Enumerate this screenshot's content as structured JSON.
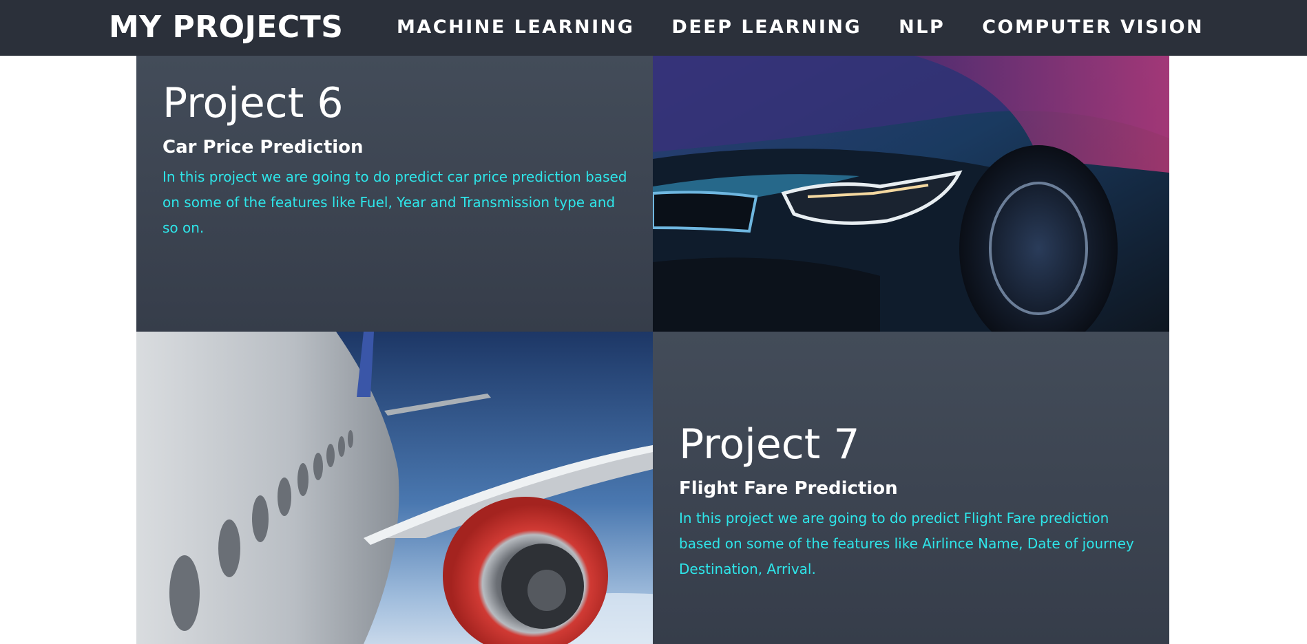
{
  "navbar": {
    "brand": "MY PROJECTS",
    "links": [
      "MACHINE LEARNING",
      "DEEP LEARNING",
      "NLP",
      "COMPUTER VISION"
    ],
    "background": "#2b303a"
  },
  "projects": [
    {
      "title": "Project 6",
      "subtitle": "Car Price Prediction",
      "description": "In this project we are going to do predict car price prediction based on some of the features like Fuel, Year and Transmission type and so on.",
      "image": "sports-car-headlight-photo"
    },
    {
      "title": "Project 7",
      "subtitle": "Flight Fare Prediction",
      "description": "In this project we are going to do predict Flight Fare prediction based on some of the features like Airlince Name, Date of journey Destination, Arrival.",
      "image": "airplane-wing-engine-photo"
    }
  ],
  "colors": {
    "panel": "#3c4350",
    "description_text": "#2ee6ea",
    "title_text": "#ffffff"
  }
}
